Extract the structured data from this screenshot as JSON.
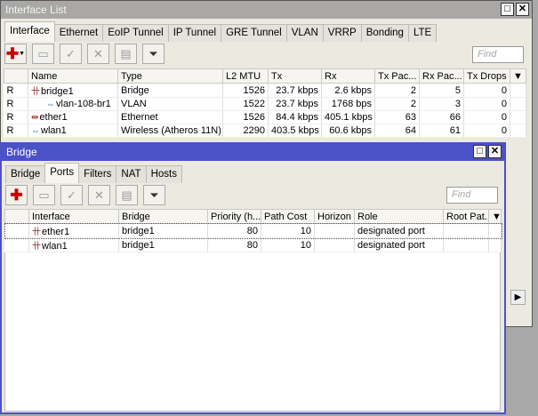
{
  "interface_window": {
    "title": "Interface List",
    "tabs": [
      "Interface",
      "Ethernet",
      "EoIP Tunnel",
      "IP Tunnel",
      "GRE Tunnel",
      "VLAN",
      "VRRP",
      "Bonding",
      "LTE"
    ],
    "active_tab": "Interface",
    "find_placeholder": "Find",
    "columns": [
      "",
      "Name",
      "Type",
      "L2 MTU",
      "Tx",
      "Rx",
      "Tx Pac...",
      "Rx Pac...",
      "Tx Drops"
    ],
    "rows": [
      {
        "flag": "R",
        "icon": "bridge-icon",
        "name": "bridge1",
        "indent": false,
        "type": "Bridge",
        "l2mtu": "1526",
        "tx": "23.7 kbps",
        "rx": "2.6 kbps",
        "txp": "2",
        "rxp": "5",
        "txd": "0"
      },
      {
        "flag": "R",
        "icon": "vlan-icon",
        "name": "vlan-108-br1",
        "indent": true,
        "type": "VLAN",
        "l2mtu": "1522",
        "tx": "23.7 kbps",
        "rx": "1768 bps",
        "txp": "2",
        "rxp": "3",
        "txd": "0"
      },
      {
        "flag": "R",
        "icon": "ethernet-icon",
        "name": "ether1",
        "indent": false,
        "type": "Ethernet",
        "l2mtu": "1526",
        "tx": "84.4 kbps",
        "rx": "405.1 kbps",
        "txp": "63",
        "rxp": "66",
        "txd": "0"
      },
      {
        "flag": "R",
        "icon": "wireless-icon",
        "name": "wlan1",
        "indent": false,
        "type": "Wireless (Atheros 11N)",
        "l2mtu": "2290",
        "tx": "403.5 kbps",
        "rx": "60.6 kbps",
        "txp": "64",
        "rxp": "61",
        "txd": "0"
      }
    ]
  },
  "bridge_window": {
    "title": "Bridge",
    "tabs": [
      "Bridge",
      "Ports",
      "Filters",
      "NAT",
      "Hosts"
    ],
    "active_tab": "Ports",
    "find_placeholder": "Find",
    "columns": [
      "",
      "Interface",
      "Bridge",
      "Priority (h...",
      "Path Cost",
      "Horizon",
      "Role",
      "Root Pat..."
    ],
    "rows": [
      {
        "interface": "ether1",
        "bridge": "bridge1",
        "priority": "80",
        "path_cost": "10",
        "horizon": "",
        "role": "designated port",
        "root_path": ""
      },
      {
        "interface": "wlan1",
        "bridge": "bridge1",
        "priority": "80",
        "path_cost": "10",
        "horizon": "",
        "role": "designated port",
        "root_path": ""
      }
    ]
  },
  "colors": {
    "active_title": "#4b51c6",
    "inactive_title": "#a9a8a6",
    "add": "#cc0000"
  }
}
